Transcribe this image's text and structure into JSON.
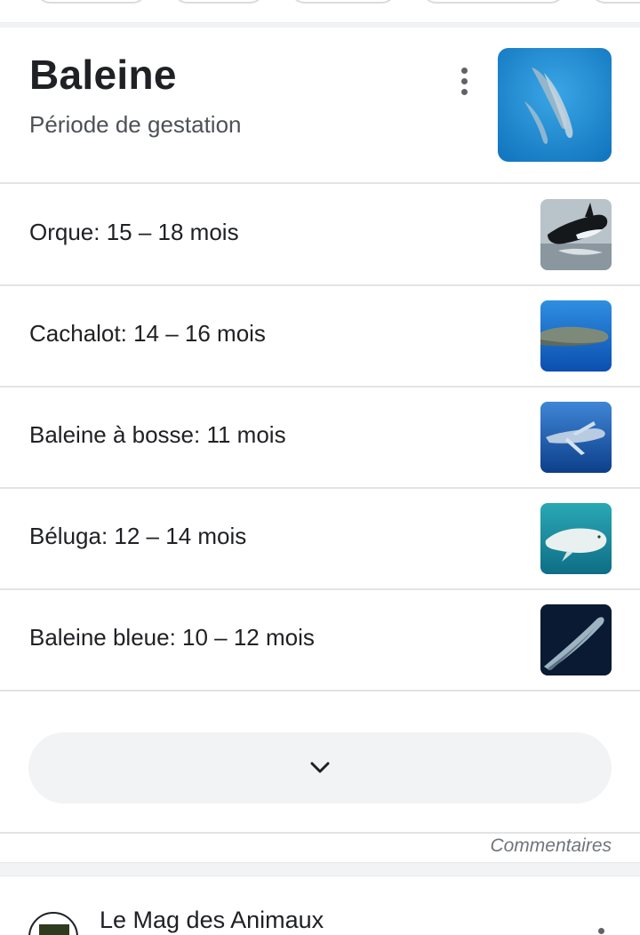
{
  "header": {
    "title": "Baleine",
    "subtitle": "Période de gestation"
  },
  "rows": [
    {
      "label": "Orque: 15 – 18 mois"
    },
    {
      "label": "Cachalot: 14 – 16 mois"
    },
    {
      "label": "Baleine à bosse: 11 mois"
    },
    {
      "label": "Béluga: 12 – 14 mois"
    },
    {
      "label": "Baleine bleue: 10 – 12 mois"
    }
  ],
  "feedback_label": "Commentaires",
  "next_result": {
    "source_name": "Le Mag des Animaux"
  },
  "icons": {
    "menu": "more-vert-icon",
    "expand": "chevron-down-icon"
  },
  "colors": {
    "ocean_blue": "#1f8fd4",
    "surface_gray": "#f1f3f4",
    "text_primary": "#202124",
    "text_secondary": "#4d5156"
  }
}
